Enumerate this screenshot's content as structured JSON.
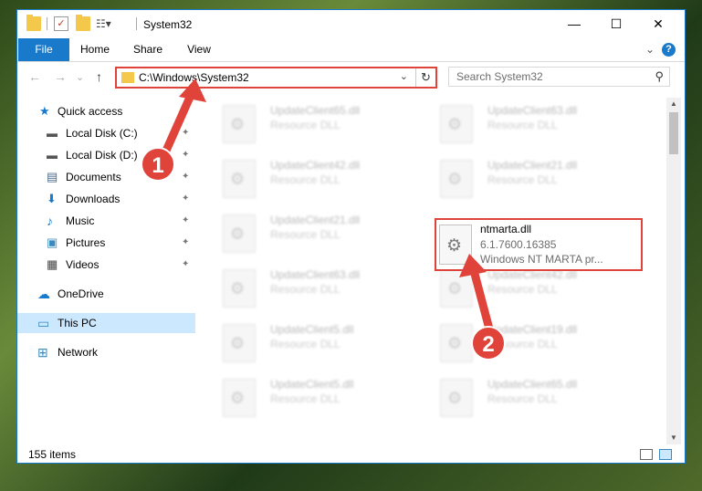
{
  "window": {
    "title": "System32",
    "minimize_glyph": "—",
    "maximize_glyph": "☐",
    "close_glyph": "✕"
  },
  "ribbon": {
    "tabs": [
      "File",
      "Home",
      "Share",
      "View"
    ],
    "expand_glyph": "⌄",
    "help_glyph": "?"
  },
  "navbar": {
    "back_glyph": "←",
    "forward_glyph": "→",
    "recent_glyph": "⌄",
    "up_glyph": "↑",
    "address": "C:\\Windows\\System32",
    "address_dropdown_glyph": "⌄",
    "refresh_glyph": "↻",
    "search_placeholder": "Search System32",
    "search_glyph": "⚲"
  },
  "sidebar": {
    "items": [
      {
        "label": "Quick access",
        "icon": "star-icon",
        "glyph": "★"
      },
      {
        "label": "Local Disk (C:)",
        "icon": "drive-icon",
        "glyph": "▬",
        "pinned": true
      },
      {
        "label": "Local Disk (D:)",
        "icon": "drive-icon",
        "glyph": "▬",
        "pinned": true
      },
      {
        "label": "Documents",
        "icon": "documents-icon",
        "glyph": "▤",
        "pinned": true
      },
      {
        "label": "Downloads",
        "icon": "download-icon",
        "glyph": "⬇",
        "pinned": true
      },
      {
        "label": "Music",
        "icon": "music-icon",
        "glyph": "♪",
        "pinned": true
      },
      {
        "label": "Pictures",
        "icon": "pictures-icon",
        "glyph": "▣",
        "pinned": true
      },
      {
        "label": "Videos",
        "icon": "videos-icon",
        "glyph": "▦",
        "pinned": true
      },
      {
        "label": "OneDrive",
        "icon": "cloud-icon",
        "glyph": "☁"
      },
      {
        "label": "This PC",
        "icon": "computer-icon",
        "glyph": "▭"
      },
      {
        "label": "Network",
        "icon": "network-icon",
        "glyph": "⊞"
      }
    ],
    "pin_glyph": "📌"
  },
  "files": {
    "left": [
      {
        "name": "UpdateClient65.dll",
        "desc": "Resource DLL"
      },
      {
        "name": "UpdateClient42.dll",
        "desc": "Resource DLL"
      },
      {
        "name": "UpdateClient21.dll",
        "desc": "Resource DLL"
      },
      {
        "name": "UpdateClient63.dll",
        "desc": "Resource DLL"
      },
      {
        "name": "UpdateClient5.dll",
        "desc": "Resource DLL"
      },
      {
        "name": "UpdateClient5.dll",
        "desc": "Resource DLL"
      }
    ],
    "right": [
      {
        "name": "UpdateClient63.dll",
        "desc": "Resource DLL"
      },
      {
        "name": "UpdateClient21.dll",
        "desc": "Resource DLL"
      },
      {
        "name": "UpdateClient42.dll",
        "desc": "Resource DLL"
      },
      {
        "name": "UpdateClient19.dll",
        "desc": "Resource DLL"
      },
      {
        "name": "UpdateClient65.dll",
        "desc": "Resource DLL"
      }
    ],
    "highlighted": {
      "name": "ntmarta.dll",
      "version": "6.1.7600.16385",
      "description": "Windows NT MARTA pr..."
    }
  },
  "status": {
    "item_count": "155 items"
  },
  "annotations": {
    "marker1": "1",
    "marker2": "2",
    "color": "#e0433a"
  }
}
